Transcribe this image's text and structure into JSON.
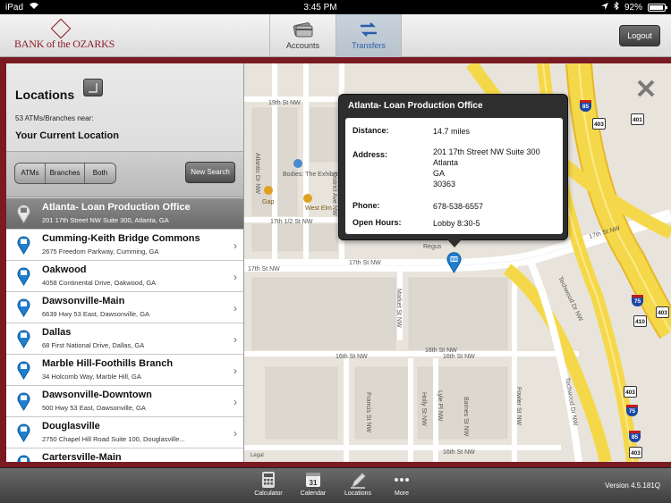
{
  "status_bar": {
    "device": "iPad",
    "time": "3:45 PM",
    "battery": "92%",
    "battery_fraction": 0.92
  },
  "header": {
    "logo_text": "BANK of the OZARKS",
    "tabs": [
      {
        "label": "Accounts",
        "icon": "credit-card-icon",
        "active": false
      },
      {
        "label": "Transfers",
        "icon": "transfer-arrows-icon",
        "active": true
      }
    ],
    "logout_label": "Logout"
  },
  "panel": {
    "title": "Locations",
    "count_text": "53 ATMs/Branches near:",
    "location_label": "Your Current Location",
    "segments": [
      "ATMs",
      "Branches",
      "Both"
    ],
    "new_search_label": "New Search",
    "items": [
      {
        "name": "Atlanta- Loan Production Office",
        "address": "201 17th Street NW Suite 300, Atlanta, GA",
        "selected": true
      },
      {
        "name": "Cumming-Keith Bridge Commons",
        "address": "2675 Freedom Parkway, Cumming, GA"
      },
      {
        "name": "Oakwood",
        "address": "4058 Continental Drive, Oakwood, GA"
      },
      {
        "name": "Dawsonville-Main",
        "address": "6639 Hwy 53 East, Dawsonville, GA"
      },
      {
        "name": "Dallas",
        "address": "68 First National Drive, Dallas, GA"
      },
      {
        "name": "Marble Hill-Foothills Branch",
        "address": "34 Holcomb Way, Marble Hill, GA"
      },
      {
        "name": "Dawsonville-Downtown",
        "address": "500 Hwy 53 East, Dawsonville, GA"
      },
      {
        "name": "Douglasville",
        "address": "2750 Chapel Hill Road Suite 100, Douglasville..."
      },
      {
        "name": "Cartersville-Main",
        "address": ""
      }
    ]
  },
  "callout": {
    "title": "Atlanta- Loan Production Office",
    "distance_label": "Distance:",
    "distance": "14.7 miles",
    "address_label": "Address:",
    "address_lines": [
      "201 17th Street NW Suite 300",
      "Atlanta",
      "GA",
      "30363"
    ],
    "phone_label": "Phone:",
    "phone": "678-538-6557",
    "hours_label": "Open Hours:",
    "hours": "Lobby 8:30-5"
  },
  "map": {
    "street_labels": {
      "s19th": "19th St NW",
      "s17half": "17th 1/2 St NW",
      "s17th_a": "17th St NW",
      "s17th_b": "17th St NW",
      "s17th_c": "17th St NW",
      "s16th_a": "16th St NW",
      "s16th_b": "16th St NW",
      "s16th_c": "16th St NW",
      "s16th_d": "16th St NW",
      "s18th": "18th St NW",
      "s15th": "15th St NW",
      "atlantic": "Atlantic Dr NW",
      "district": "District Ave NW",
      "market": "Market St NW",
      "francis": "Francis St NW",
      "holly": "Holly St NW",
      "lyle": "Lyle Pl NW",
      "barnes": "Barnes St NW",
      "fowler": "Fowler St NW",
      "techwood_a": "Techwood Dr NW",
      "techwood_b": "Techwood Dr NW"
    },
    "poi": {
      "bodies": "Bodies: The Exhibition",
      "gap": "Gap",
      "west_elm": "West Elm",
      "regus": "Regus"
    },
    "shields": [
      "85",
      "403",
      "401",
      "75",
      "410",
      "403",
      "403",
      "75",
      "85",
      "403"
    ],
    "legal": "Legal"
  },
  "toolbar": {
    "items": [
      {
        "label": "Calculator",
        "icon": "calculator-icon"
      },
      {
        "label": "Calendar",
        "icon": "calendar-icon",
        "badge": "31"
      },
      {
        "label": "Locations",
        "icon": "locations-pen-icon"
      },
      {
        "label": "More",
        "icon": "more-dots-icon"
      }
    ],
    "version": "Version 4.5.181Q"
  },
  "colors": {
    "brand": "#8b1c24",
    "highway": "#f5d84a",
    "map_bg": "#e8e4dc",
    "accent": "#2a5fa8"
  }
}
